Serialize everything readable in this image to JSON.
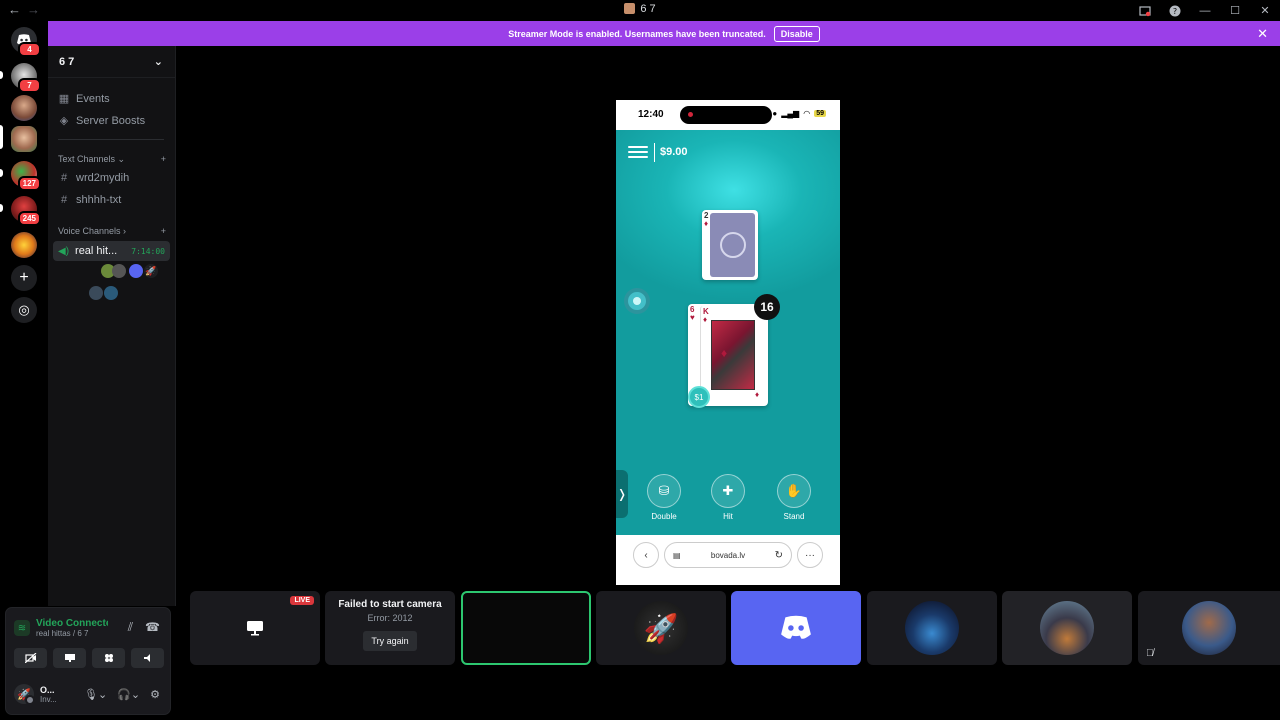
{
  "titlebar": {
    "back": "←",
    "forward": "→",
    "title": "6 7",
    "icons": [
      "inbox-icon",
      "help-icon"
    ],
    "minimize": "—",
    "maximize": "☐",
    "close": "✕"
  },
  "rail": {
    "servers": [
      {
        "name": "home",
        "badge": "4"
      },
      {
        "name": "server-1",
        "badge": "7"
      },
      {
        "name": "server-2",
        "badge": ""
      },
      {
        "name": "server-3",
        "badge": ""
      },
      {
        "name": "server-4",
        "badge": "127"
      },
      {
        "name": "server-5",
        "badge": "245"
      },
      {
        "name": "server-6",
        "badge": ""
      }
    ],
    "add_label": "+",
    "discover_label": "◎"
  },
  "banner": {
    "text": "Streamer Mode is enabled. Usernames have been truncated.",
    "button": "Disable",
    "close": "✕"
  },
  "sidebar": {
    "guild_name": "6 7",
    "chevron": "⌄",
    "events": "Events",
    "boosts": "Server Boosts",
    "text_section": "Text Channels ⌄",
    "voice_section": "Voice Channels ›",
    "add": "+",
    "text_channels": [
      "wrd2mydih",
      "shhhh-txt"
    ],
    "voice_channel": {
      "name": "real hit...",
      "timer": "7:14:00"
    }
  },
  "userpanel": {
    "status": "Video Connected",
    "location": "real hittas / 6 7",
    "user_name": "O...",
    "user_status": "Inv..."
  },
  "phone": {
    "time": "12:40",
    "battery": "59",
    "balance": "$9.00",
    "dealer_card_rank": "2",
    "player_card_ranks": [
      "6",
      "K"
    ],
    "score": "16",
    "bet": "$1",
    "side_tab": "❭",
    "actions": [
      {
        "label": "Double",
        "icon": "⛁"
      },
      {
        "label": "Hit",
        "icon": "✚"
      },
      {
        "label": "Stand",
        "icon": "✋"
      }
    ],
    "url": "bovada.lv",
    "back_btn": "‹",
    "more_btn": "···",
    "reload": "↻"
  },
  "tiles": {
    "live_badge": "LIVE",
    "fail_title": "Failed to start camera",
    "fail_error": "Error: 2012",
    "retry": "Try again"
  },
  "colors": {
    "banner": "#9b3fe8",
    "discord_blurple": "#5865f2",
    "game_teal": "#1ab5b6",
    "voice_green": "#23a55a"
  }
}
